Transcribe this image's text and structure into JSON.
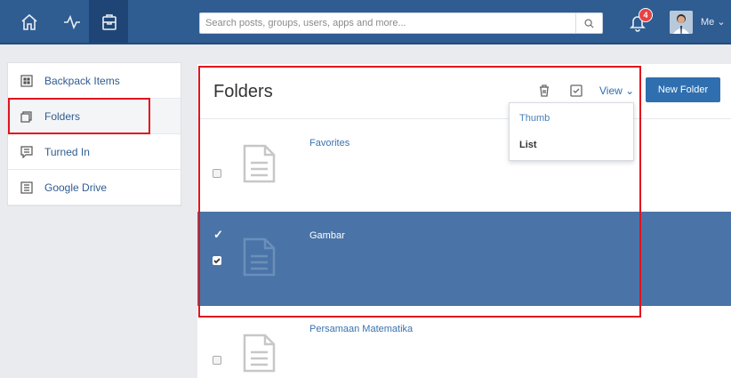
{
  "nav": {
    "icons": [
      "home-icon",
      "activity-icon",
      "backpack-icon"
    ],
    "search_placeholder": "Search posts, groups, users, apps and more...",
    "notification_count": "4",
    "user_label": "Me"
  },
  "sidebar": {
    "items": [
      {
        "label": "Backpack Items",
        "icon": "grid-icon"
      },
      {
        "label": "Folders",
        "icon": "folders-icon",
        "active": true
      },
      {
        "label": "Turned In",
        "icon": "comment-icon"
      },
      {
        "label": "Google Drive",
        "icon": "document-icon"
      }
    ]
  },
  "main": {
    "title": "Folders",
    "view_label": "View",
    "new_folder_label": "New Folder",
    "view_menu": {
      "thumb": "Thumb",
      "list": "List"
    },
    "folders": [
      {
        "name": "Favorites",
        "checked": false
      },
      {
        "name": "Gambar",
        "checked": true
      },
      {
        "name": "Persamaan Matematika",
        "checked": false
      }
    ]
  },
  "colors": {
    "topbar": "#2f5c91",
    "accent": "#2f6fb0",
    "selected_row": "#4a74a7",
    "highlight_box": "#e0141e"
  }
}
